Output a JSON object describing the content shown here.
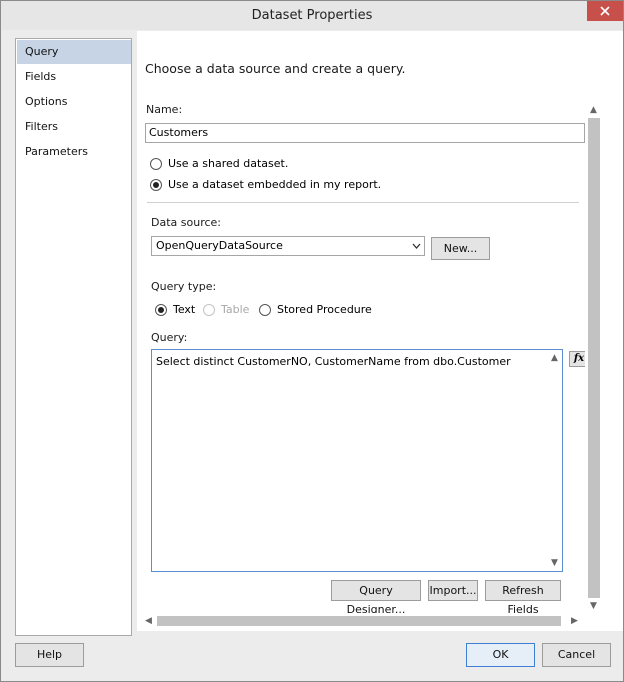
{
  "window": {
    "title": "Dataset Properties"
  },
  "sidebar": {
    "items": [
      {
        "label": "Query",
        "selected": true
      },
      {
        "label": "Fields",
        "selected": false
      },
      {
        "label": "Options",
        "selected": false
      },
      {
        "label": "Filters",
        "selected": false
      },
      {
        "label": "Parameters",
        "selected": false
      }
    ]
  },
  "main": {
    "heading": "Choose a data source and create a query.",
    "name_label": "Name:",
    "name_value": "Customers",
    "dataset_options": [
      {
        "label": "Use a shared dataset.",
        "selected": false
      },
      {
        "label": "Use a dataset embedded in my report.",
        "selected": true
      }
    ],
    "data_source_label": "Data source:",
    "data_source_value": "OpenQueryDataSource",
    "new_button": "New...",
    "query_type_label": "Query type:",
    "query_types": [
      {
        "label": "Text",
        "selected": true,
        "enabled": true
      },
      {
        "label": "Table",
        "selected": false,
        "enabled": false
      },
      {
        "label": "Stored Procedure",
        "selected": false,
        "enabled": true
      }
    ],
    "query_label": "Query:",
    "query_value": "Select distinct CustomerNO, CustomerName from dbo.Customer",
    "fx_button": "fx",
    "query_designer_button": "Query Designer...",
    "import_button": "Import...",
    "refresh_fields_button": "Refresh Fields"
  },
  "footer": {
    "help_button": "Help",
    "ok_button": "OK",
    "cancel_button": "Cancel"
  },
  "colors": {
    "selected_nav": "#c6d4e6",
    "close_button": "#c7504b",
    "focus_border": "#5c8fd1"
  }
}
